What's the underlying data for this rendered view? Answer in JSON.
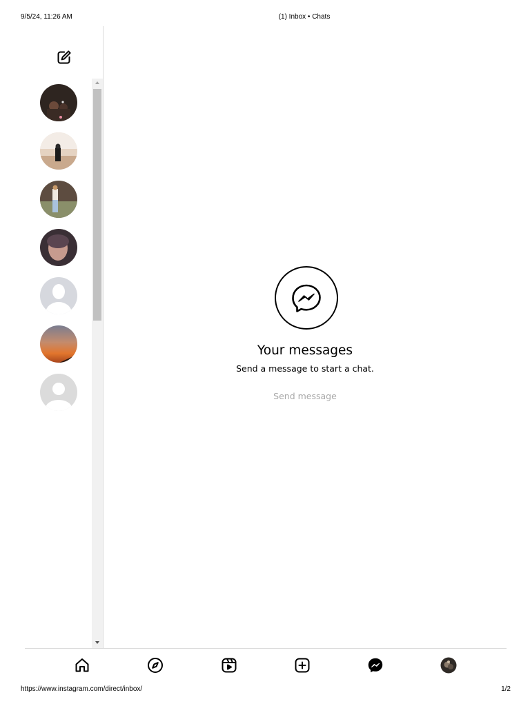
{
  "print_header": {
    "date": "9/5/24, 11:26 AM",
    "title": "(1) Inbox • Chats"
  },
  "print_footer": {
    "url": "https://www.instagram.com/direct/inbox/",
    "page": "1/2"
  },
  "sidebar": {
    "compose_icon": "edit-square-icon",
    "conversations": [
      {
        "avatar": "user-photo"
      },
      {
        "avatar": "user-photo"
      },
      {
        "avatar": "user-photo"
      },
      {
        "avatar": "user-photo"
      },
      {
        "avatar": "default-profile"
      },
      {
        "avatar": "user-photo"
      },
      {
        "avatar": "default-profile"
      }
    ]
  },
  "empty_state": {
    "icon": "messenger-icon",
    "title": "Your messages",
    "subtitle": "Send a message to start a chat.",
    "button_label": "Send message"
  },
  "bottom_nav": [
    {
      "icon": "home-icon"
    },
    {
      "icon": "explore-icon"
    },
    {
      "icon": "reels-icon"
    },
    {
      "icon": "create-icon"
    },
    {
      "icon": "messenger-icon"
    },
    {
      "icon": "profile-avatar"
    }
  ],
  "colors": {
    "border": "#dbdbdb",
    "muted_text": "#a8a8a8",
    "scrollbar_track": "#f1f1f1",
    "scrollbar_thumb": "#c1c1c1"
  }
}
